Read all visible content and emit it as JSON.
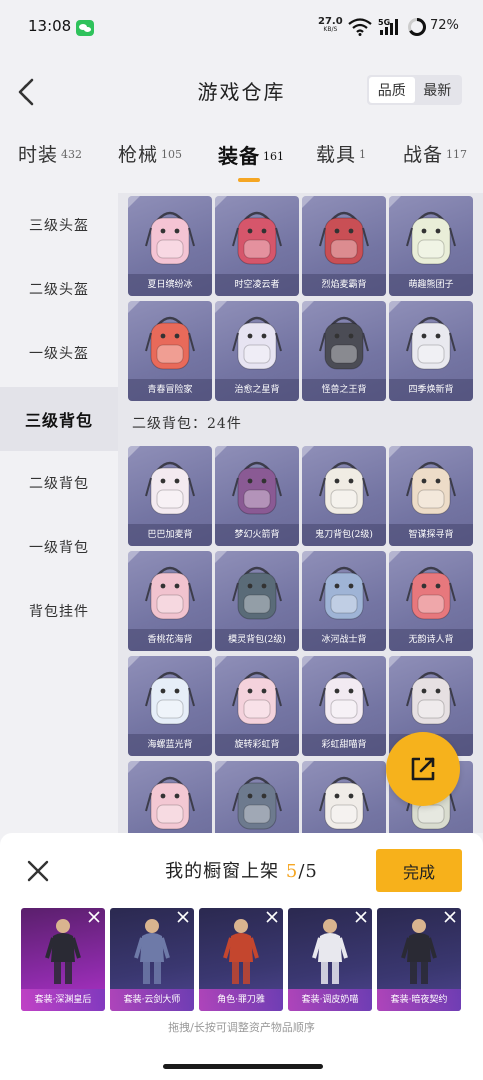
{
  "status_bar": {
    "time": "13:08",
    "net_speed": "27.0",
    "net_unit": "KB/S",
    "network": "5G",
    "battery": "72%"
  },
  "header": {
    "title": "游戏仓库",
    "sort_options": [
      "品质",
      "最新"
    ],
    "active_sort": "品质"
  },
  "category_tabs": [
    {
      "label": "时装",
      "count": "432"
    },
    {
      "label": "枪械",
      "count": "105"
    },
    {
      "label": "装备",
      "count": "161",
      "active": true
    },
    {
      "label": "载具",
      "count": "1"
    },
    {
      "label": "战备",
      "count": "117"
    }
  ],
  "sidebar": {
    "items": [
      "三级头盔",
      "二级头盔",
      "一级头盔",
      "三级背包",
      "二级背包",
      "一级背包",
      "背包挂件"
    ],
    "active": "三级背包"
  },
  "level3_bags": [
    {
      "name": "夏日缤纷冰",
      "color": "#f4c4d4"
    },
    {
      "name": "时空凌云者",
      "color": "#d6566b"
    },
    {
      "name": "烈焰麦霸背",
      "color": "#c94f55"
    },
    {
      "name": "萌趣熊团子",
      "color": "#e9eed8"
    },
    {
      "name": "青春冒险家",
      "color": "#e86a5a"
    },
    {
      "name": "治愈之星背",
      "color": "#e7e4f2"
    },
    {
      "name": "怪兽之王背",
      "color": "#4b4c55"
    },
    {
      "name": "四季焕新背",
      "color": "#e9e9ef"
    }
  ],
  "section_label": "二级背包：24件",
  "level2_bags": [
    {
      "name": "巴巴加麦背",
      "color": "#f3eaf0"
    },
    {
      "name": "梦幻火箭背",
      "color": "#8a5a94"
    },
    {
      "name": "鬼刀背包(2级)",
      "color": "#f0ece4"
    },
    {
      "name": "智谋探寻背",
      "color": "#eddcc8"
    },
    {
      "name": "香桃花海背",
      "color": "#f1c3cf"
    },
    {
      "name": "模灵背包(2级)",
      "color": "#5a6b78"
    },
    {
      "name": "冰河战士背",
      "color": "#9fb4d6"
    },
    {
      "name": "无韵诗人背",
      "color": "#e7787d"
    },
    {
      "name": "海螺蓝光背",
      "color": "#e6eef8"
    },
    {
      "name": "旋转彩虹背",
      "color": "#f4d2dc"
    },
    {
      "name": "彩虹甜喵背",
      "color": "#f2eaf2"
    },
    {
      "name": "",
      "color": "#e6e0e2"
    },
    {
      "name": "",
      "color": "#f3c8d3"
    },
    {
      "name": "",
      "color": "#6d7a8e"
    },
    {
      "name": "",
      "color": "#f0ece8"
    },
    {
      "name": "",
      "color": "#d9dccf"
    }
  ],
  "showcase": {
    "title_prefix": "我的橱窗上架",
    "current": "5",
    "total": "/5",
    "done_label": "完成",
    "items": [
      {
        "label": "套装·深渊皇后",
        "style": "pink"
      },
      {
        "label": "套装·云剑大师",
        "style": "dark"
      },
      {
        "label": "角色·罪刀雅",
        "style": "dark"
      },
      {
        "label": "套装·调皮奶喵",
        "style": "dark"
      },
      {
        "label": "套装·暗夜契约",
        "style": "dark"
      }
    ],
    "hint": "拖拽/长按可调整资产物品顺序"
  }
}
